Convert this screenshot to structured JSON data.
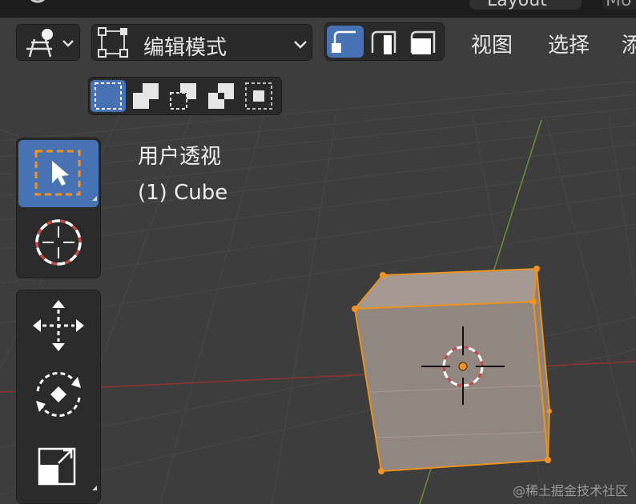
{
  "top_tabs": [
    {
      "label": "Layout",
      "active": true
    },
    {
      "label": "Mo",
      "active": false
    }
  ],
  "header": {
    "view_mode_icon": "object-interaction-icon",
    "mode_select": {
      "value": "编辑模式",
      "icon": "edit-mode-icon"
    },
    "select_modes": [
      {
        "name": "vertex-select",
        "active": true
      },
      {
        "name": "edge-select",
        "active": false
      },
      {
        "name": "face-select",
        "active": false
      }
    ],
    "menu": [
      "视图",
      "选择",
      "添"
    ]
  },
  "box_modes": [
    {
      "name": "set-new-selection",
      "active": true
    },
    {
      "name": "extend-selection",
      "active": false
    },
    {
      "name": "subtract-selection",
      "active": false
    },
    {
      "name": "invert-selection",
      "active": false
    },
    {
      "name": "intersect-selection",
      "active": false
    }
  ],
  "toolbar": [
    {
      "name": "select-box",
      "active": true
    },
    {
      "name": "cursor",
      "active": false
    },
    {
      "name": "move",
      "active": false
    },
    {
      "name": "rotate",
      "active": false
    },
    {
      "name": "scale",
      "active": false
    }
  ],
  "viewport": {
    "view_label": "用户透视",
    "object_label": "(1) Cube"
  },
  "watermark": "@稀土掘金技术社区",
  "colors": {
    "active_blue": "#4772b3",
    "selection_orange": "#f5931e",
    "x_axis": "#9a3a3a",
    "y_axis": "#6f8c35"
  }
}
